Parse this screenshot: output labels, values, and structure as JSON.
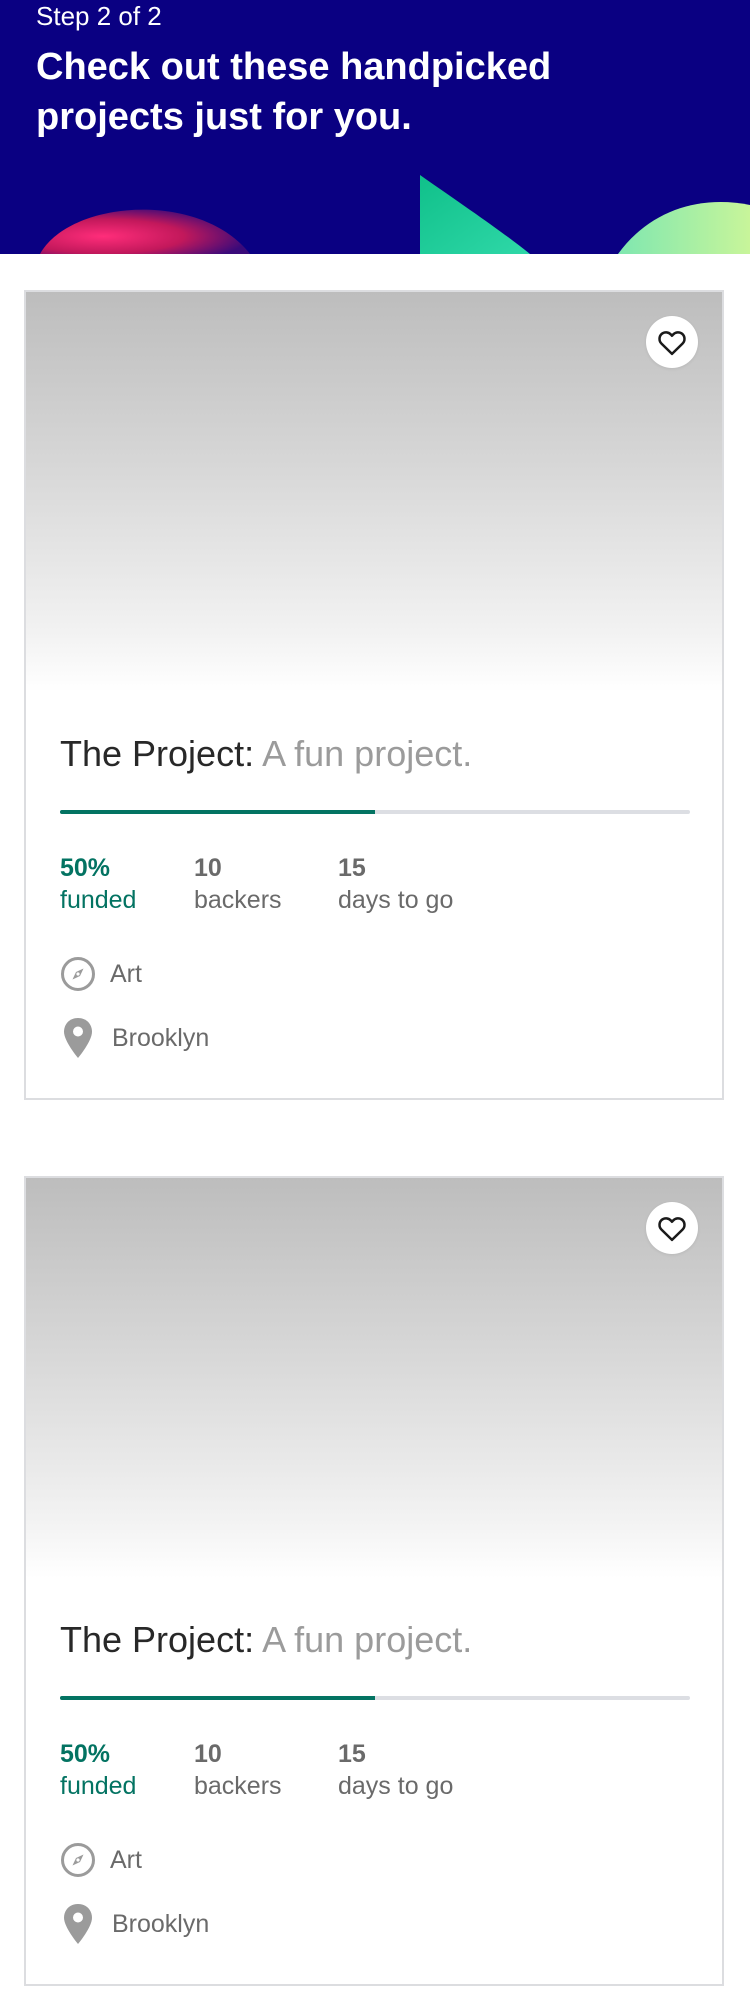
{
  "header": {
    "step": "Step 2 of 2",
    "title": "Check out these handpicked projects just for you."
  },
  "colors": {
    "header_bg": "#0a0082",
    "accent_green": "#037362",
    "muted_text": "#6a6a6a",
    "blurb_text": "#9b9b9b"
  },
  "projects": [
    {
      "name": "The Project:",
      "blurb": "A fun project.",
      "percent_funded": 0.5,
      "funded_value": "50%",
      "funded_label": "funded",
      "backers_value": "10",
      "backers_label": "backers",
      "days_value": "15",
      "days_label": "days to go",
      "category": "Art",
      "location": "Brooklyn",
      "icons": {
        "save": "heart-icon",
        "category": "compass-icon",
        "location": "location-pin-icon"
      }
    },
    {
      "name": "The Project:",
      "blurb": "A fun project.",
      "percent_funded": 0.5,
      "funded_value": "50%",
      "funded_label": "funded",
      "backers_value": "10",
      "backers_label": "backers",
      "days_value": "15",
      "days_label": "days to go",
      "category": "Art",
      "location": "Brooklyn",
      "icons": {
        "save": "heart-icon",
        "category": "compass-icon",
        "location": "location-pin-icon"
      }
    }
  ]
}
